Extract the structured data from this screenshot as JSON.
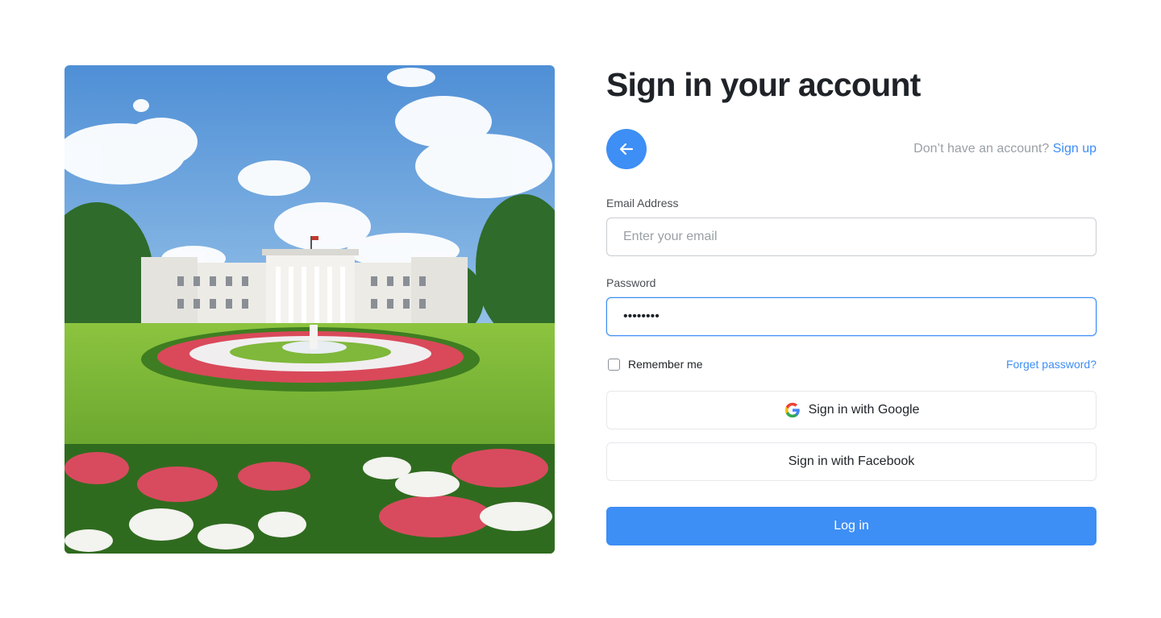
{
  "hero": {
    "image_icon": "garden-building-illustration"
  },
  "form": {
    "title": "Sign in your account",
    "back_icon": "arrow-left-icon",
    "signup_prompt": "Don’t have an account?",
    "signup_link": "Sign up",
    "email_label": "Email Address",
    "email_placeholder": "Enter your email",
    "email_value": "",
    "password_label": "Password",
    "password_value": "••••••••",
    "remember_label": "Remember me",
    "remember_checked": false,
    "forget_link": "Forget password?",
    "google_button": "Sign in with Google",
    "google_icon": "google-icon",
    "facebook_button": "Sign in with Facebook",
    "login_button": "Log in"
  },
  "colors": {
    "accent": "#3d8ef5",
    "text": "#1f2328",
    "muted": "#9aa0a6",
    "border": "#c9cdd2"
  }
}
